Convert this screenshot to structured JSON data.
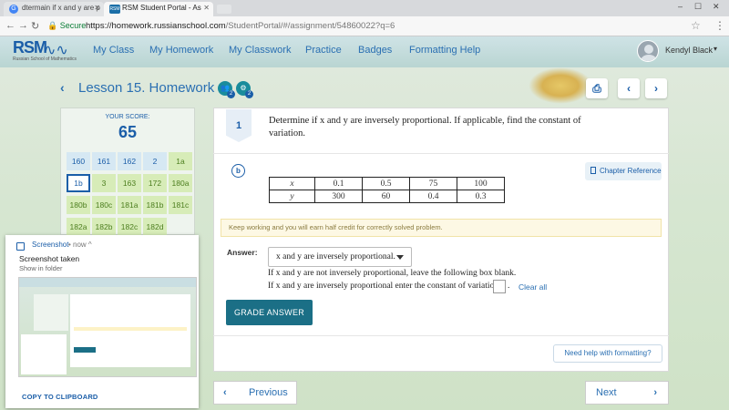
{
  "browser": {
    "tabs": [
      {
        "label": "dtermain if x and y are p",
        "favicon": "google-icon"
      },
      {
        "label": "RSM Student Portal - As",
        "favicon": "rsm-icon"
      }
    ],
    "secure_label": "Secure",
    "url_host": "https://homework.russianschool.com",
    "url_path": "/StudentPortal/#/assignment/54860022?q=6"
  },
  "site": {
    "logo": "RSM",
    "logo_sub": "Russian School of Mathematics",
    "nav": [
      "My Class",
      "My Homework",
      "My Classwork",
      "Practice",
      "Badges",
      "Formatting Help"
    ],
    "user_name": "Kendyl Black"
  },
  "lesson": {
    "title": "Lesson 15. Homework",
    "icon_badges": [
      "2",
      "2"
    ]
  },
  "score": {
    "label": "YOUR SCORE:",
    "value": "65",
    "cells": [
      [
        "160",
        "161",
        "162",
        "2",
        "1a"
      ],
      [
        "1b",
        "3",
        "163",
        "172",
        "180a"
      ],
      [
        "180b",
        "180c",
        "181a",
        "181b",
        "181c"
      ],
      [
        "182a",
        "182b",
        "182c",
        "182d"
      ]
    ]
  },
  "question": {
    "number": "1",
    "text_line1": "Determine if x and y are inversely proportional. If applicable, find the constant of",
    "text_line2": "variation.",
    "part": "b",
    "chapter_ref": "Chapter Reference",
    "table": {
      "x_label": "x",
      "y_label": "y",
      "x_values": [
        "0.1",
        "0.5",
        "75",
        "100"
      ],
      "y_values": [
        "300",
        "60",
        "0.4",
        "0.3"
      ]
    },
    "hint": "Keep working and you will earn half credit for correctly solved problem.",
    "answer_label": "Answer:",
    "answer_selected": "x and y are inversely proportional.",
    "line1": "If x and y are not inversely proportional, leave the following box blank.",
    "line2": "If x and y are inversely proportional enter the constant of variation",
    "line2_end": ".",
    "clear_all": "Clear all",
    "grade_button": "GRADE ANSWER",
    "help_button": "Need help with formatting?"
  },
  "pager": {
    "previous": "Previous",
    "next": "Next"
  },
  "notification": {
    "app": "Screenshot",
    "time": "• now ^",
    "title": "Screenshot taken",
    "subtitle": "Show in folder",
    "action": "COPY TO CLIPBOARD"
  },
  "colors": {
    "brand_blue": "#1b5ea8",
    "grade_button": "#1b6f86",
    "cell_blue": "#d6e8f3",
    "cell_green": "#d7ecb8"
  }
}
